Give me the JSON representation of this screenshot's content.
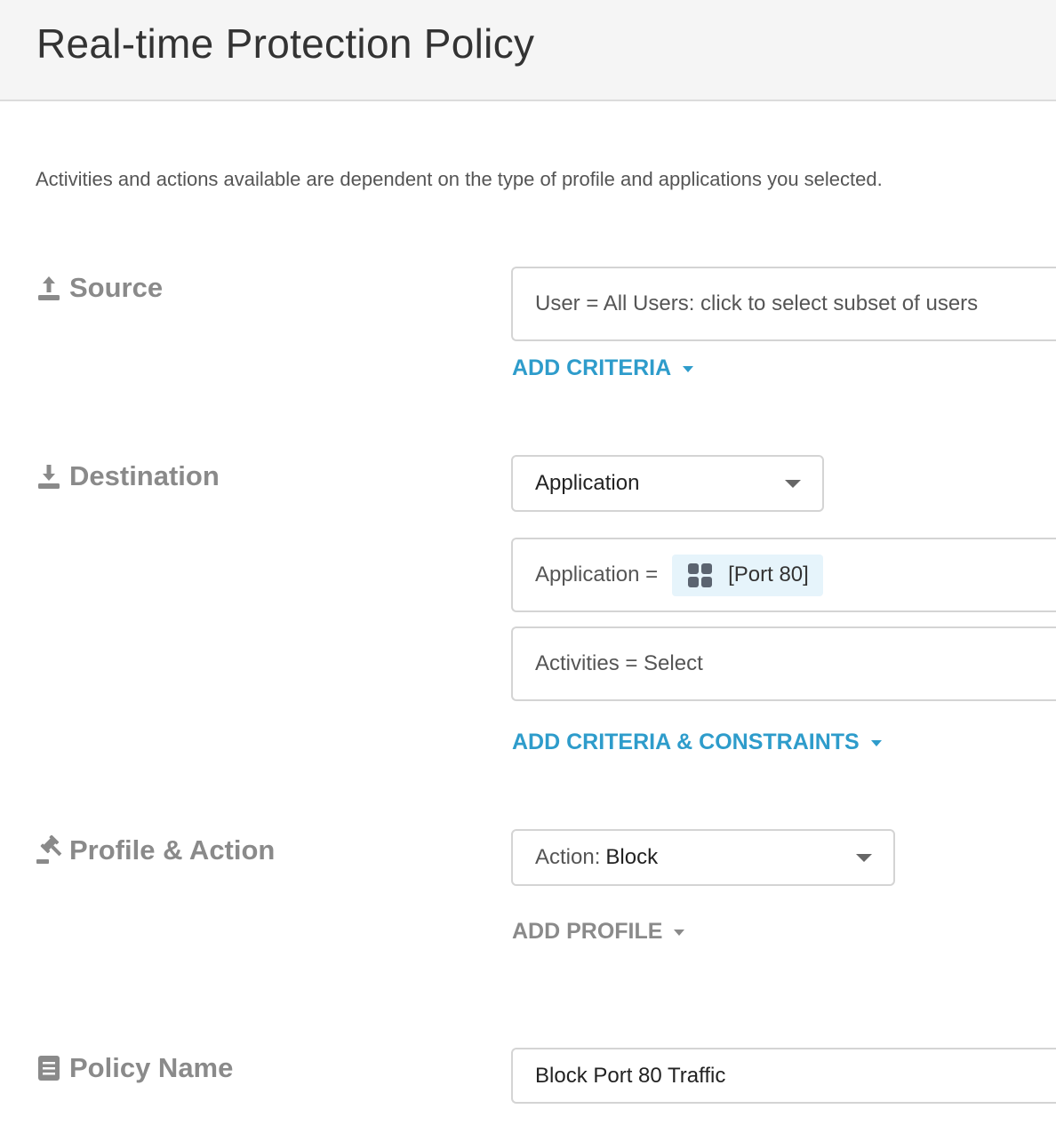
{
  "header": {
    "title": "Real-time Protection Policy"
  },
  "intro": "Activities and actions available are dependent on the type of profile and applications you selected.",
  "source": {
    "label": "Source",
    "user_field": "User = All Users: click to select subset of users",
    "add_criteria": "ADD CRITERIA"
  },
  "destination": {
    "label": "Destination",
    "type_select": "Application",
    "application_label": "Application =",
    "application_chip": "[Port 80]",
    "activities_field": "Activities = Select",
    "add_criteria": "ADD CRITERIA & CONSTRAINTS"
  },
  "profile_action": {
    "label": "Profile & Action",
    "action_prefix": "Action:",
    "action_value": "Block",
    "add_profile": "ADD PROFILE"
  },
  "policy_name": {
    "label": "Policy Name",
    "value": "Block Port 80 Traffic"
  },
  "colors": {
    "link_blue": "#2e9ccb",
    "label_gray": "#8a8a8a",
    "chip_bg": "#e6f4fb",
    "header_bg": "#f5f5f5"
  },
  "icons": {
    "source": "upload-icon",
    "destination": "download-icon",
    "profile_action": "gavel-icon",
    "policy_name": "document-icon",
    "application_chip": "apps-grid-icon"
  }
}
